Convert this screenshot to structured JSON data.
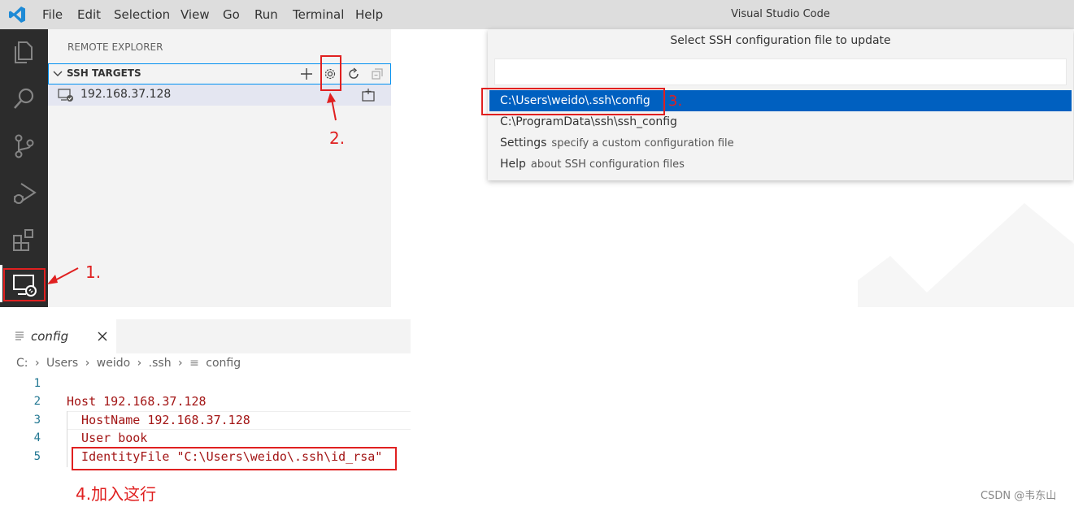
{
  "titlebar": {
    "menu": [
      "File",
      "Edit",
      "Selection",
      "View",
      "Go",
      "Run",
      "Terminal",
      "Help"
    ],
    "title": "Visual Studio Code"
  },
  "activitybar": {
    "icons": [
      "explorer-icon",
      "search-icon",
      "source-control-icon",
      "run-debug-icon",
      "extensions-icon",
      "remote-explorer-icon"
    ]
  },
  "sidebar": {
    "header": "REMOTE EXPLORER",
    "section_title": "SSH TARGETS",
    "target": "192.168.37.128"
  },
  "quickpick": {
    "title": "Select SSH configuration file to update",
    "input_value": "",
    "items": [
      {
        "label": "C:\\Users\\weido\\.ssh\\config",
        "desc": ""
      },
      {
        "label": "C:\\ProgramData\\ssh\\ssh_config",
        "desc": ""
      },
      {
        "label": "Settings",
        "desc": "specify a custom configuration file"
      },
      {
        "label": "Help",
        "desc": "about SSH configuration files"
      }
    ]
  },
  "editor": {
    "tab_label": "config",
    "breadcrumb": [
      "C:",
      "Users",
      "weido",
      ".ssh",
      "config"
    ],
    "lines": [
      {
        "n": "1",
        "text": ""
      },
      {
        "n": "2",
        "text": "Host 192.168.37.128"
      },
      {
        "n": "3",
        "text": "  HostName 192.168.37.128"
      },
      {
        "n": "4",
        "text": "  User book"
      },
      {
        "n": "5",
        "text": "  IdentityFile \"C:\\Users\\weido\\.ssh\\id_rsa\""
      }
    ]
  },
  "annotations": {
    "a1": "1.",
    "a2": "2.",
    "a3": "3.",
    "a4": "4.加入这行"
  },
  "watermark": "CSDN @韦东山",
  "colors": {
    "accent": "#0060c0",
    "annotation": "#e02020",
    "code": "#a31515",
    "line_number": "#237893"
  }
}
